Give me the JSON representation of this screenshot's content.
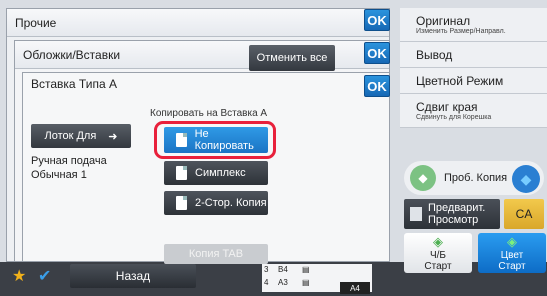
{
  "dialog1": {
    "title": "Прочие",
    "ok_label": "OK"
  },
  "dialog2": {
    "title": "Обложки/Вставки",
    "cancel_all_label": "Отменить все",
    "ok_label": "OK"
  },
  "dialog3": {
    "title": "Вставка Типа A",
    "ok_label": "OK",
    "tray_button_label": "Лоток Для",
    "tray_value_line1": "Ручная подача",
    "tray_value_line2": "Обычная 1",
    "copy_options_label": "Копировать на Вставка A",
    "options": [
      {
        "label": "Не Копировать",
        "selected": true
      },
      {
        "label": "Симплекс",
        "selected": false
      },
      {
        "label": "2-Стор. Копия",
        "selected": false
      }
    ],
    "tab_copy_label": "Копия TAB"
  },
  "sidebar": {
    "items": [
      {
        "label": "Оригинал",
        "sublabel": "Изменить Размер/Направл."
      },
      {
        "label": "Вывод",
        "sublabel": ""
      },
      {
        "label": "Цветной Режим",
        "sublabel": ""
      },
      {
        "label": "Сдвиг края",
        "sublabel": "Сдвинуть для Корешка"
      }
    ]
  },
  "actions": {
    "preview_copy_label": "Проб. Копия",
    "preview_label_line1": "Предварит.",
    "preview_label_line2": "Просмотр",
    "ca_label": "CA",
    "start_bw_line1": "Ч/Б",
    "start_bw_line2": "Старт",
    "start_color_line1": "Цвет",
    "start_color_line2": "Старт"
  },
  "bottom_bar": {
    "back_label": "Назад",
    "paper": [
      {
        "tray": "3",
        "size": "B4"
      },
      {
        "tray": "4",
        "size": "A3"
      }
    ],
    "current_paper": "A4"
  },
  "colors": {
    "accent_blue": "#1b74c4",
    "highlight_red": "#e8203b",
    "ca_yellow": "#f2c94c"
  }
}
